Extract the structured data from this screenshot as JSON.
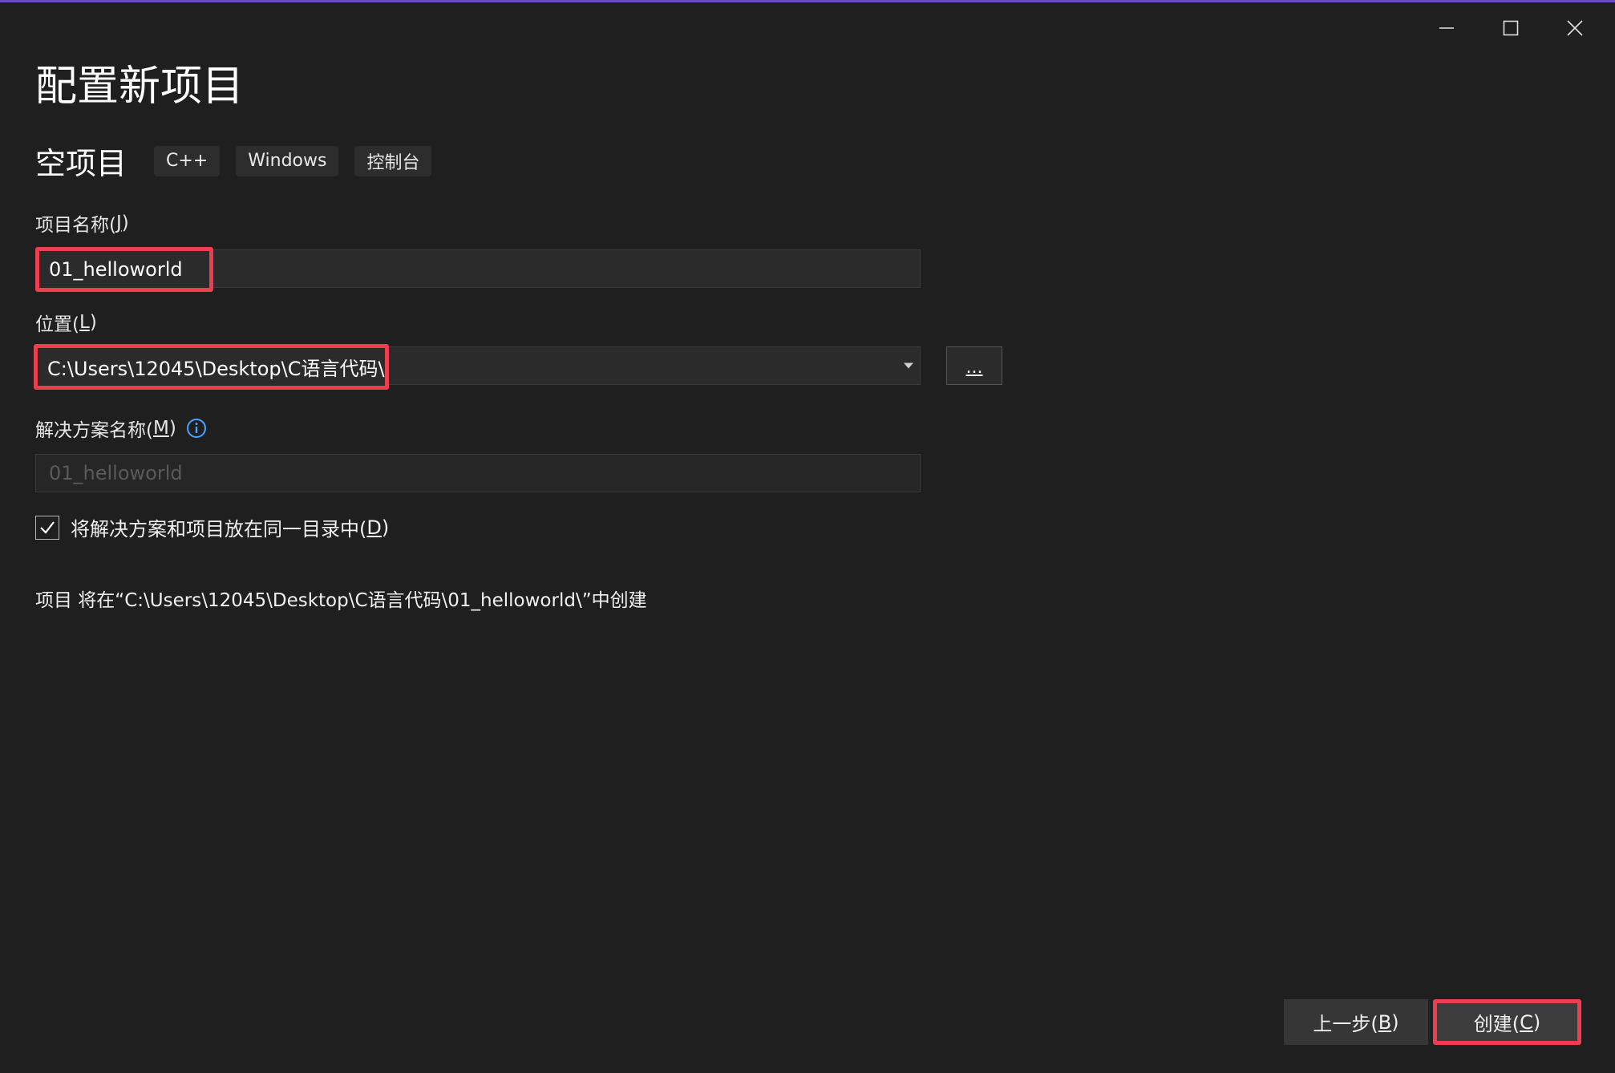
{
  "window": {
    "controls": {
      "minimize": "minimize-icon",
      "maximize": "maximize-icon",
      "close": "close-icon"
    }
  },
  "page_title": "配置新项目",
  "template": {
    "name": "空项目",
    "tags": [
      "C++",
      "Windows",
      "控制台"
    ]
  },
  "project_name": {
    "label": "项目名称(",
    "label_key": "J",
    "label_end": ")",
    "value": "01_helloworld"
  },
  "location": {
    "label": "位置(",
    "label_key": "L",
    "label_end": ")",
    "value": "C:\\Users\\12045\\Desktop\\C语言代码\\",
    "browse_label": "..."
  },
  "solution_name": {
    "label": "解决方案名称(",
    "label_key": "M",
    "label_end": ")",
    "value": "01_helloworld",
    "info_icon": "info-icon"
  },
  "same_directory": {
    "checked": true,
    "label": "将解决方案和项目放在同一目录中(",
    "label_key": "D",
    "label_end": ")"
  },
  "summary": "项目 将在“C:\\Users\\12045\\Desktop\\C语言代码\\01_helloworld\\”中创建",
  "footer": {
    "back": {
      "label": "上一步(",
      "key": "B",
      "end": ")"
    },
    "create": {
      "label": "创建(",
      "key": "C",
      "end": ")"
    }
  },
  "colors": {
    "background": "#1f1f1f",
    "highlight_border": "#ee3d4f",
    "accent_top": "#6b4fbf",
    "info": "#4aa3ff"
  }
}
